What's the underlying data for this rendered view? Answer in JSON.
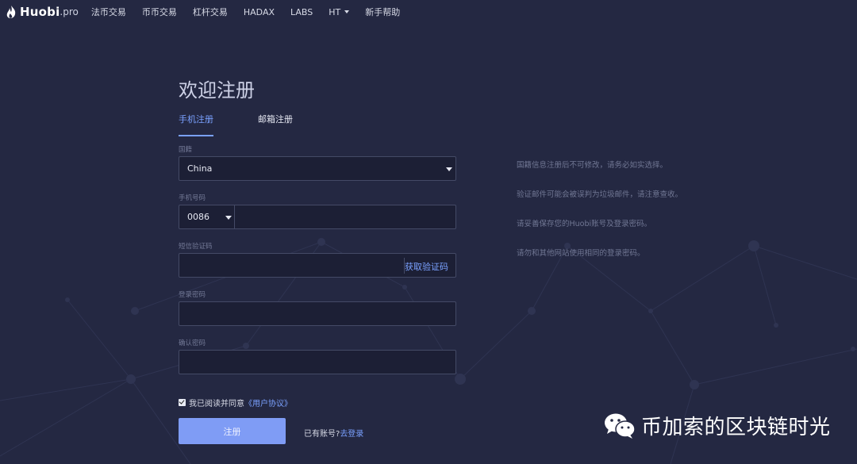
{
  "app": {
    "logo_text": "Huobi",
    "logo_suffix": ".pro"
  },
  "nav": {
    "items": [
      "法币交易",
      "币币交易",
      "杠杆交易",
      "HADAX",
      "LABS",
      "HT",
      "新手帮助"
    ]
  },
  "form": {
    "title": "欢迎注册",
    "tabs": [
      {
        "label": "手机注册",
        "active": true
      },
      {
        "label": "邮箱注册",
        "active": false
      }
    ],
    "country": {
      "label": "国籍",
      "value": "China"
    },
    "phone": {
      "label": "手机号码",
      "prefix": "0086",
      "value": ""
    },
    "sms": {
      "label": "短信验证码",
      "value": "",
      "button": "获取验证码"
    },
    "password": {
      "label": "登录密码",
      "value": ""
    },
    "confirm": {
      "label": "确认密码",
      "value": ""
    },
    "agree": {
      "text": "我已阅读并同意",
      "link": "《用户协议》",
      "checked": true
    },
    "submit": "注册",
    "login_prompt": "已有账号?",
    "login_link": "去登录"
  },
  "tips": [
    "国籍信息注册后不可修改，请务必如实选择。",
    "验证邮件可能会被误判为垃圾邮件，请注意查收。",
    "请妥善保存您的Huobi账号及登录密码。",
    "请勿和其他网站使用相同的登录密码。"
  ],
  "watermark": {
    "text": "币加索的区块链时光",
    "icon": "wechat-icon"
  },
  "colors": {
    "background": "#242842",
    "accent": "#7aa1ff",
    "button": "#7f9cf5"
  }
}
